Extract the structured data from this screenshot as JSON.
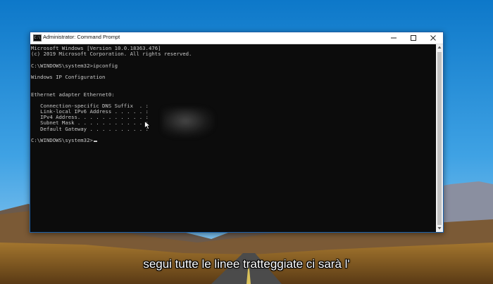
{
  "window": {
    "title": "Administrator: Command Prompt",
    "icon_label": "C:\\",
    "controls": {
      "minimize": "minimize-icon",
      "maximize": "maximize-icon",
      "close": "close-icon"
    }
  },
  "console": {
    "header_line1": "Microsoft Windows [Version 10.0.18363.476]",
    "header_line2": "(c) 2019 Microsoft Corporation. All rights reserved.",
    "command_line": "C:\\WINDOWS\\system32>ipconfig",
    "ip_config_title": "Windows IP Configuration",
    "adapter_title": "Ethernet adapter Ethernet0:",
    "fields": [
      "   Connection-specific DNS Suffix  . :",
      "   Link-local IPv6 Address . . . . . :",
      "   IPv4 Address. . . . . . . . . . . :",
      "   Subnet Mask . . . . . . . . . . . :",
      "   Default Gateway . . . . . . . . . :"
    ],
    "prompt_line": "C:\\WINDOWS\\system32>"
  },
  "subtitle": "segui tutte le linee tratteggiate ci sarà l'",
  "colors": {
    "console_bg": "#0c0c0c",
    "console_text": "#c8c8c8",
    "sky": "#1d8fd8"
  }
}
